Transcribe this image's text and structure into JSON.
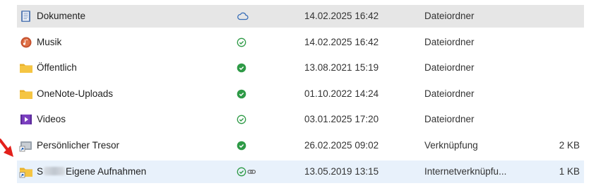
{
  "rows": [
    {
      "name": "Dokumente",
      "status": "cloud",
      "date": "14.02.2025 16:42",
      "type": "Dateiordner",
      "size": "",
      "icon": "documents-folder-icon",
      "selected": "gray"
    },
    {
      "name": "Musik",
      "status": "check-outline",
      "date": "14.02.2025 16:42",
      "type": "Dateiordner",
      "size": "",
      "icon": "music-folder-icon"
    },
    {
      "name": "Öffentlich",
      "status": "check-filled",
      "date": "13.08.2021 15:19",
      "type": "Dateiordner",
      "size": "",
      "icon": "folder-icon"
    },
    {
      "name": "OneNote-Uploads",
      "status": "check-filled",
      "date": "01.10.2022 14:24",
      "type": "Dateiordner",
      "size": "",
      "icon": "folder-icon"
    },
    {
      "name": "Videos",
      "status": "check-outline",
      "date": "03.01.2025 17:20",
      "type": "Dateiordner",
      "size": "",
      "icon": "videos-folder-icon"
    },
    {
      "name": "Persönlicher Tresor",
      "status": "check-filled",
      "date": "26.02.2025 09:02",
      "type": "Verknüpfung",
      "size": "2 KB",
      "icon": "vault-shortcut-icon"
    },
    {
      "name_prefix": "S",
      "name": "Eigene Aufnahmen",
      "status": "check-outline-link",
      "date": "13.05.2019 13:15",
      "type": "Internetverknüpfu...",
      "size": "1 KB",
      "icon": "folder-shortcut-icon",
      "selected": "blue"
    }
  ],
  "colors": {
    "check": "#2e9a46",
    "cloud": "#3a6fb8",
    "folder": "#f5c542",
    "arrow": "#e3201b",
    "select_gray": "#e6e6e6",
    "select_blue": "#e8f1fb"
  }
}
